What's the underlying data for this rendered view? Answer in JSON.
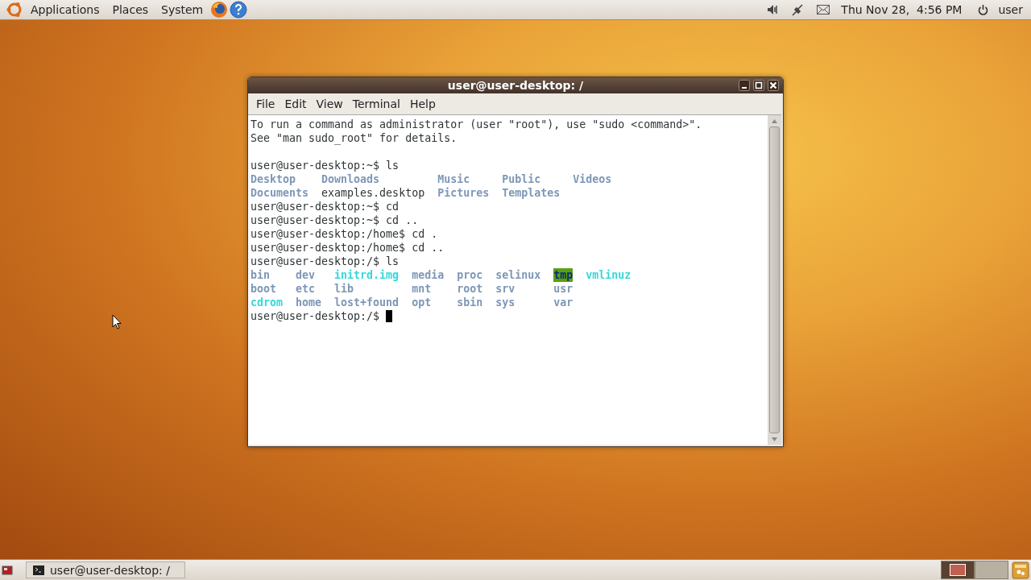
{
  "top_panel": {
    "menus": [
      {
        "label": "Applications"
      },
      {
        "label": "Places"
      },
      {
        "label": "System"
      }
    ],
    "clock": "Thu Nov 28,  4:56 PM",
    "user": "user"
  },
  "window": {
    "title": "user@user-desktop: /",
    "menu": [
      {
        "label": "File"
      },
      {
        "label": "Edit"
      },
      {
        "label": "View"
      },
      {
        "label": "Terminal"
      },
      {
        "label": "Help"
      }
    ]
  },
  "terminal": {
    "blocks": [
      {
        "kind": "line",
        "text": "To run a command as administrator (user \"root\"), use \"sudo <command>\"."
      },
      {
        "kind": "line",
        "text": "See \"man sudo_root\" for details."
      },
      {
        "kind": "blank"
      },
      {
        "kind": "line",
        "text": "user@user-desktop:~$ ls"
      },
      {
        "kind": "listing",
        "columns": [
          [
            {
              "name": "Desktop",
              "kind": "dir"
            },
            {
              "name": "Documents",
              "kind": "dir"
            }
          ],
          [
            {
              "name": "Downloads",
              "kind": "dir"
            },
            {
              "name": "examples.desktop",
              "kind": "file"
            }
          ],
          [
            {
              "name": "Music",
              "kind": "dir"
            },
            {
              "name": "Pictures",
              "kind": "dir"
            }
          ],
          [
            {
              "name": "Public",
              "kind": "dir"
            },
            {
              "name": "Templates",
              "kind": "dir"
            }
          ],
          [
            {
              "name": "Videos",
              "kind": "dir"
            }
          ]
        ]
      },
      {
        "kind": "line",
        "text": "user@user-desktop:~$ cd"
      },
      {
        "kind": "line",
        "text": "user@user-desktop:~$ cd .."
      },
      {
        "kind": "line",
        "text": "user@user-desktop:/home$ cd ."
      },
      {
        "kind": "line",
        "text": "user@user-desktop:/home$ cd .."
      },
      {
        "kind": "line",
        "text": "user@user-desktop:/$ ls"
      },
      {
        "kind": "listing",
        "columns": [
          [
            {
              "name": "bin",
              "kind": "dir"
            },
            {
              "name": "boot",
              "kind": "dir"
            },
            {
              "name": "cdrom",
              "kind": "link"
            }
          ],
          [
            {
              "name": "dev",
              "kind": "dir"
            },
            {
              "name": "etc",
              "kind": "dir"
            },
            {
              "name": "home",
              "kind": "dir"
            }
          ],
          [
            {
              "name": "initrd.img",
              "kind": "link"
            },
            {
              "name": "lib",
              "kind": "dir"
            },
            {
              "name": "lost+found",
              "kind": "dir"
            }
          ],
          [
            {
              "name": "media",
              "kind": "dir"
            },
            {
              "name": "mnt",
              "kind": "dir"
            },
            {
              "name": "opt",
              "kind": "dir"
            }
          ],
          [
            {
              "name": "proc",
              "kind": "dir"
            },
            {
              "name": "root",
              "kind": "dir"
            },
            {
              "name": "sbin",
              "kind": "dir"
            }
          ],
          [
            {
              "name": "selinux",
              "kind": "dir"
            },
            {
              "name": "srv",
              "kind": "dir"
            },
            {
              "name": "sys",
              "kind": "dir"
            }
          ],
          [
            {
              "name": "tmp",
              "kind": "sticky"
            },
            {
              "name": "usr",
              "kind": "dir"
            },
            {
              "name": "var",
              "kind": "dir"
            }
          ],
          [
            {
              "name": "vmlinuz",
              "kind": "link"
            }
          ]
        ]
      },
      {
        "kind": "prompt",
        "text": "user@user-desktop:/$ "
      }
    ]
  },
  "taskbar": {
    "tasks": [
      {
        "label": "user@user-desktop: /",
        "selected": false
      }
    ],
    "workspaces": [
      {
        "selected": true
      },
      {
        "selected": false
      }
    ]
  }
}
